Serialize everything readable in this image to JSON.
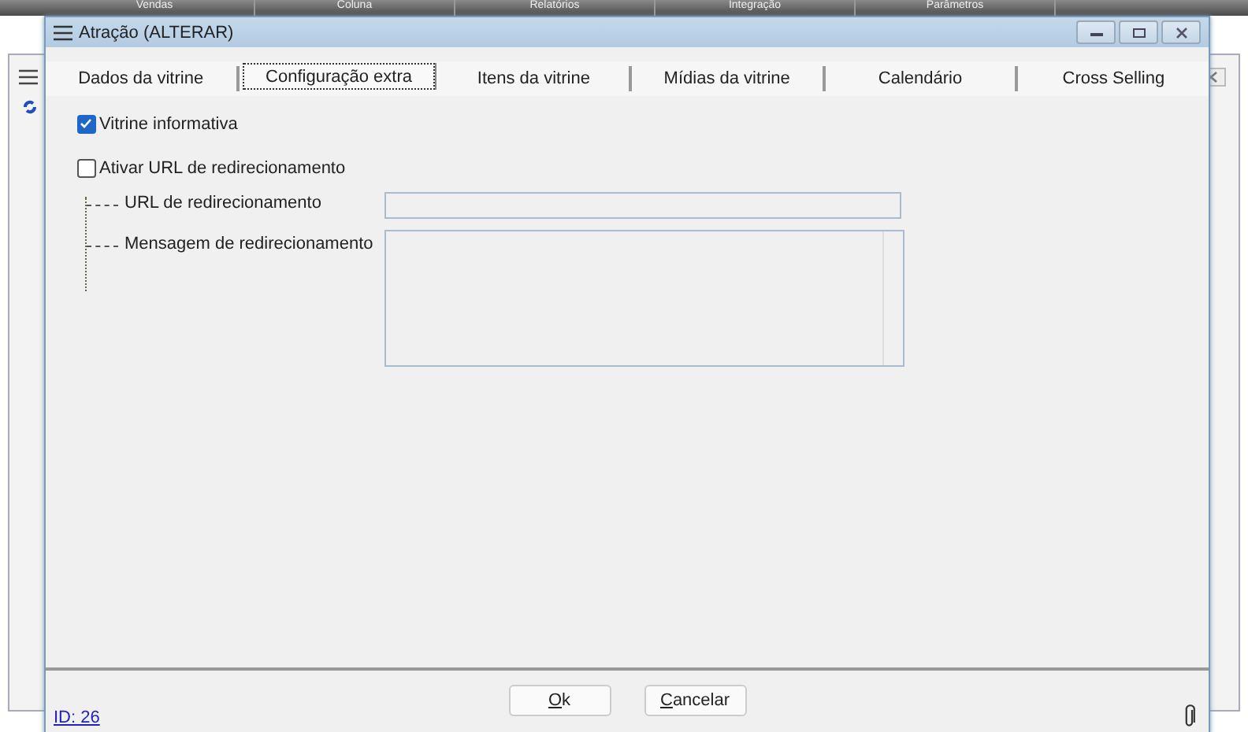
{
  "background_app": {
    "menu": [
      "Vendas",
      "Coluna",
      "Relatórios",
      "Integração",
      "Parâmetros"
    ]
  },
  "window": {
    "title": "Atração (ALTERAR)"
  },
  "tabs": [
    {
      "label": "Dados da vitrine",
      "selected": false
    },
    {
      "label": "Configuração extra",
      "selected": true
    },
    {
      "label": "Itens da vitrine",
      "selected": false
    },
    {
      "label": "Mídias da vitrine",
      "selected": false
    },
    {
      "label": "Calendário",
      "selected": false
    },
    {
      "label": "Cross Selling",
      "selected": false
    }
  ],
  "form": {
    "vitrine_informativa": {
      "label": "Vitrine informativa",
      "checked": true
    },
    "ativar_url": {
      "label": "Ativar URL de redirecionamento",
      "checked": false
    },
    "url_label": "URL de redirecionamento",
    "mensagem_label": "Mensagem de redirecionamento"
  },
  "footer": {
    "id_link": "ID: 26",
    "buttons": [
      {
        "label": "Ok"
      },
      {
        "label": "Cancelar"
      }
    ]
  }
}
